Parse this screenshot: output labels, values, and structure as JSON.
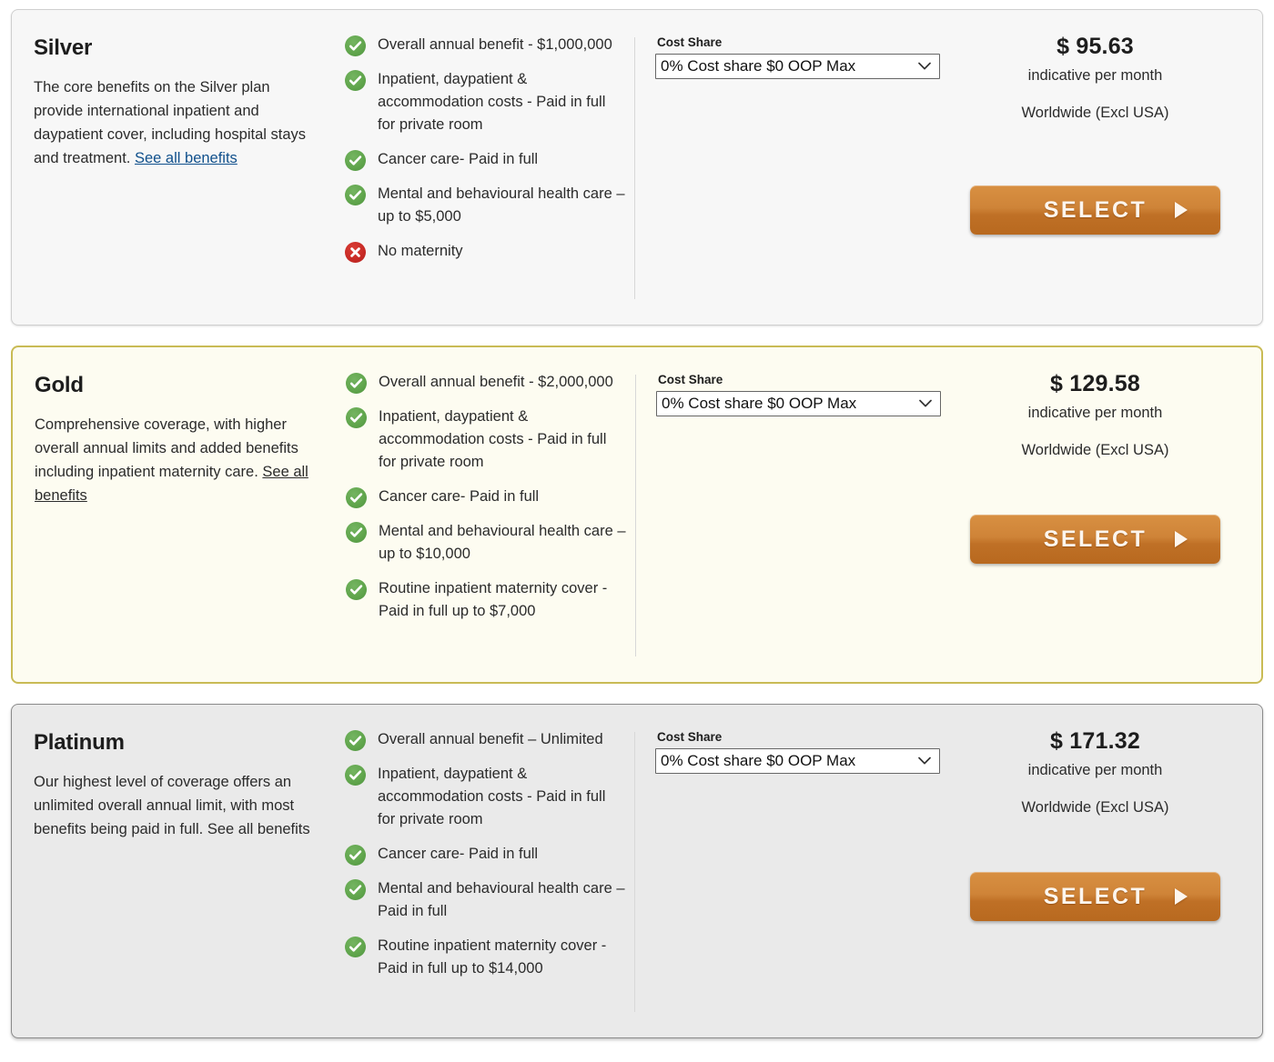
{
  "common": {
    "cost_share_label": "Cost Share",
    "cost_share_value": "0% Cost share $0 OOP Max",
    "cost_share_options": [
      "0% Cost share $0 OOP Max"
    ],
    "price_sub": "indicative per month",
    "price_region": "Worldwide (Excl USA)",
    "select_label": "SELECT",
    "accent_color": "#c07f33",
    "yes_color": "#5aa34a",
    "no_color": "#c82a25",
    "link_color": "#10508c"
  },
  "plans": [
    {
      "name": "Silver",
      "description_text": "The core benefits on the Silver plan provide international inpatient and daypatient cover, including hospital stays and treatment. ",
      "see_all_label": "See all benefits",
      "see_all_style": "link",
      "price": "$ 95.63",
      "card_style": "silver",
      "benefits": [
        {
          "status": "yes",
          "text": "Overall annual benefit - $1,000,000"
        },
        {
          "status": "yes",
          "text": "Inpatient, daypatient & accommodation costs - Paid in full for private room"
        },
        {
          "status": "yes",
          "text": "Cancer care- Paid in full"
        },
        {
          "status": "yes",
          "text": "Mental and behavioural health care – up to $5,000"
        },
        {
          "status": "no",
          "text": "No maternity"
        }
      ]
    },
    {
      "name": "Gold",
      "description_text": "Comprehensive coverage, with higher overall annual limits and added benefits including inpatient maternity care. ",
      "see_all_label": "See all benefits",
      "see_all_style": "plain-underline",
      "price": "$ 129.58",
      "card_style": "gold",
      "benefits": [
        {
          "status": "yes",
          "text": "Overall annual benefit - $2,000,000"
        },
        {
          "status": "yes",
          "text": "Inpatient, daypatient & accommodation costs - Paid in full for private room"
        },
        {
          "status": "yes",
          "text": "Cancer care- Paid in full"
        },
        {
          "status": "yes",
          "text": "Mental and behavioural health care – up to $10,000"
        },
        {
          "status": "yes",
          "text": "Routine inpatient maternity cover - Paid in full up to $7,000"
        }
      ]
    },
    {
      "name": "Platinum",
      "description_text": "Our highest level of coverage offers an unlimited overall annual limit, with most benefits being paid in full. ",
      "see_all_label": "See all benefits",
      "see_all_style": "no-underline",
      "price": "$ 171.32",
      "card_style": "platinum",
      "benefits": [
        {
          "status": "yes",
          "text": "Overall annual benefit – Unlimited"
        },
        {
          "status": "yes",
          "text": "Inpatient, daypatient & accommodation costs - Paid in full for private room"
        },
        {
          "status": "yes",
          "text": "Cancer care- Paid in full"
        },
        {
          "status": "yes",
          "text": "Mental and behavioural health care – Paid in full"
        },
        {
          "status": "yes",
          "text": "Routine inpatient maternity cover - Paid in full up to $14,000"
        }
      ]
    }
  ]
}
